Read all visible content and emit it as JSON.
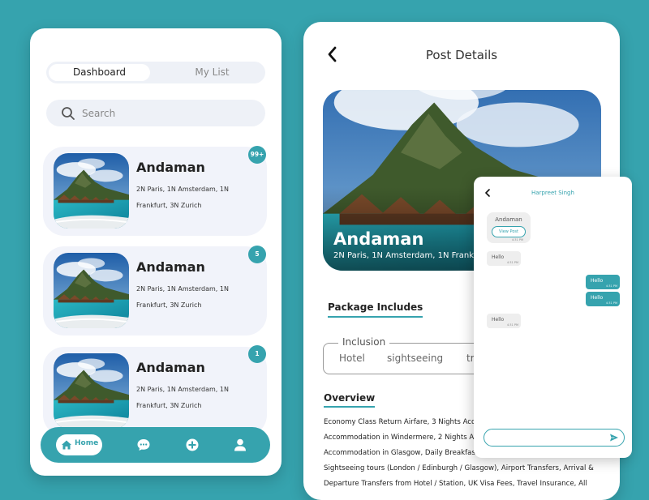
{
  "colors": {
    "accent": "#36a3ae",
    "background": "#36a3ae",
    "card": "#f1f3fa"
  },
  "dashboard": {
    "tabs": [
      {
        "label": "Dashboard",
        "active": true
      },
      {
        "label": "My List",
        "active": false
      }
    ],
    "search": {
      "placeholder": "Search",
      "value": "",
      "icon": "search-icon"
    },
    "cards": [
      {
        "title": "Andaman",
        "description": "2N Paris, 1N Amsterdam, 1N Frankfurt, 3N Zurich",
        "badge": "99+"
      },
      {
        "title": "Andaman",
        "description": "2N Paris, 1N Amsterdam, 1N Frankfurt, 3N Zurich",
        "badge": "5"
      },
      {
        "title": "Andaman",
        "description": "2N Paris, 1N Amsterdam, 1N Frankfurt, 3N Zurich",
        "badge": "1"
      }
    ],
    "nav": {
      "home_label": "Home",
      "icons": [
        "home-icon",
        "chat-icon",
        "add-icon",
        "profile-icon"
      ]
    }
  },
  "post": {
    "title": "Post Details",
    "hero": {
      "title": "Andaman",
      "description": "2N Paris, 1N Amsterdam, 1N Frankfurt, 3N Zurich"
    },
    "section_tab": "Package Includes",
    "inclusion": {
      "legend": "Inclusion",
      "items": [
        "Hotel",
        "sightseeing",
        "tr"
      ]
    },
    "overview": {
      "title": "Overview",
      "lines": [
        "Economy Class Return Airfare, 3 Nights Acc",
        "Accommodation in Windermere, 2 Nights Acc",
        "Accommodation in Glasgow, Daily Breakfast",
        "Sightseeing tours (London / Edinburgh / Glasgow), Airport Transfers, Arrival &",
        "Departure Transfers from Hotel / Station, UK Visa Fees, Travel Insurance, All"
      ]
    }
  },
  "chat": {
    "name": "Harpreet Singh",
    "post_bubble": {
      "title": "Andaman",
      "button": "View Post",
      "time": "4:31 PM"
    },
    "messages": [
      {
        "text": "Hello",
        "time": "4:31 PM",
        "from": "them"
      },
      {
        "text": "Hello",
        "time": "4:31 PM",
        "from": "me"
      },
      {
        "text": "Hello",
        "time": "4:31 PM",
        "from": "me"
      },
      {
        "text": "Hello",
        "time": "4:31 PM",
        "from": "them"
      }
    ],
    "input": {
      "value": "",
      "placeholder": ""
    }
  }
}
